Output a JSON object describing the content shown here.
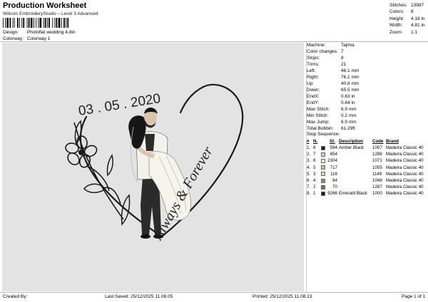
{
  "header": {
    "title": "Production Worksheet",
    "subtitle": "Wilcom EmbroideryStudio – Level 3 Advanced",
    "design_label": "Design:",
    "design_value": "Photoflat wedding 4,8in",
    "colorway_label": "Colorway:",
    "colorway_value": "Colorway 1"
  },
  "stats": [
    {
      "label": "Stitches:",
      "value": "13987"
    },
    {
      "label": "Colors:",
      "value": "8"
    },
    {
      "label": "Height:",
      "value": "4.18 in"
    },
    {
      "label": "Width:",
      "value": "4.81 in"
    },
    {
      "label": "Zoom:",
      "value": "1:1"
    }
  ],
  "design": {
    "date_text": "03 . 05 . 2020",
    "script_text": "Always & Forever",
    "colors": {
      "background": "#e3e3e3",
      "outline": "#1a1a1a",
      "dress": "#f4f4ea",
      "suit": "#2b2b2b",
      "skin": "#d9c4ae",
      "hair": "#161616"
    }
  },
  "machine": [
    {
      "label": "Machine:",
      "value": "Tajima"
    },
    {
      "label": "Color changes:",
      "value": "7"
    },
    {
      "label": "Stops:",
      "value": "8"
    },
    {
      "label": "Trims:",
      "value": "21"
    },
    {
      "label": "Left:",
      "value": "46.1 mm"
    },
    {
      "label": "Right:",
      "value": "76.1 mm"
    },
    {
      "label": "Up:",
      "value": "40.8 mm"
    },
    {
      "label": "Down:",
      "value": "65.5 mm"
    },
    {
      "label": "EndX:",
      "value": "0.63 in"
    },
    {
      "label": "EndY:",
      "value": "0.44 in"
    },
    {
      "label": "Max Stitch:",
      "value": "6.9 mm"
    },
    {
      "label": "Min Stitch:",
      "value": "0.2 mm"
    },
    {
      "label": "Max Jump:",
      "value": "6.9 mm"
    },
    {
      "label": "Total Bobbin:",
      "value": "61.29ft"
    }
  ],
  "stop_sequence": {
    "label": "Stop Sequence:",
    "headers": {
      "num": "#",
      "n": "N.",
      "st": "St.",
      "description": "Description",
      "code": "Code",
      "brand": "Brand"
    },
    "rows": [
      {
        "num": "1.",
        "n": "8",
        "swatch": "#1a1a1a",
        "st": "594",
        "description": "Amber Black",
        "code": "1007",
        "brand": "Madeira Classic 40"
      },
      {
        "num": "2.",
        "n": "7",
        "swatch": "#cfcfcf",
        "st": "854",
        "description": "",
        "code": "1286",
        "brand": "Madeira Classic 40"
      },
      {
        "num": "3.",
        "n": "6",
        "swatch": "#efece0",
        "st": "2304",
        "description": "",
        "code": "1071",
        "brand": "Madeira Classic 40"
      },
      {
        "num": "4.",
        "n": "5",
        "swatch": "#d9b89a",
        "st": "717",
        "description": "",
        "code": "1055",
        "brand": "Madeira Classic 40"
      },
      {
        "num": "5.",
        "n": "3",
        "swatch": "#e7d3c4",
        "st": "116",
        "description": "",
        "code": "1149",
        "brand": "Madeira Classic 40"
      },
      {
        "num": "6.",
        "n": "4",
        "swatch": "#7f9a5a",
        "st": "64",
        "description": "",
        "code": "1048",
        "brand": "Madeira Classic 40"
      },
      {
        "num": "7.",
        "n": "2",
        "swatch": "#6e6e6e",
        "st": "70",
        "description": "",
        "code": "1287",
        "brand": "Madeira Classic 40"
      },
      {
        "num": "8.",
        "n": "1",
        "swatch": "#1a1a1a",
        "st": "9266",
        "description": "Emerald Black",
        "code": "1000",
        "brand": "Madeira Classic 40"
      }
    ]
  },
  "footer": {
    "created_by": "Created By:",
    "last_saved": "Last Saved: 25/12/2025 11.08.05",
    "printed": "Printed: 25/12/2025 11.08.13",
    "page": "Page 1 of 1"
  }
}
